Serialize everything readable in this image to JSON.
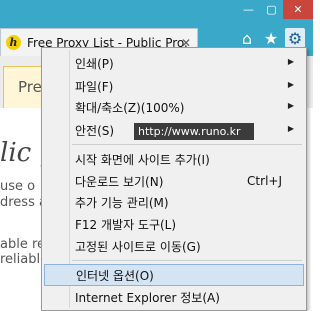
{
  "tab": {
    "favicon": "h",
    "title": "Free Proxy List - Public Pro...",
    "close": "✕"
  },
  "page": {
    "tab_label": "Pre",
    "heading": "lic pro",
    "line1": "use o",
    "line2": "dress a",
    "line3": "able re",
    "line4": "reliable"
  },
  "menu": {
    "items": [
      {
        "label": "인쇄(P)",
        "submenu": "▶"
      },
      {
        "label": "파일(F)",
        "submenu": "▶"
      },
      {
        "label": "확대/축소(Z)(100%)",
        "submenu": "▶"
      },
      {
        "label": "안전(S)",
        "submenu": "▶"
      },
      {
        "label": "시작 화면에 사이트 추가(I)"
      },
      {
        "label": "다운로드 보기(N)",
        "shortcut": "Ctrl+J"
      },
      {
        "label": "추가 기능 관리(M)"
      },
      {
        "label": "F12 개발자 도구(L)"
      },
      {
        "label": "고정된 사이트로 이동(G)"
      },
      {
        "label": "인터넷 옵션(O)"
      },
      {
        "label": "Internet Explorer 정보(A)"
      }
    ]
  },
  "tooltip": "http://www.runo.kr",
  "window": {
    "minimize": "—",
    "maximize": "▢",
    "close": "✕"
  }
}
